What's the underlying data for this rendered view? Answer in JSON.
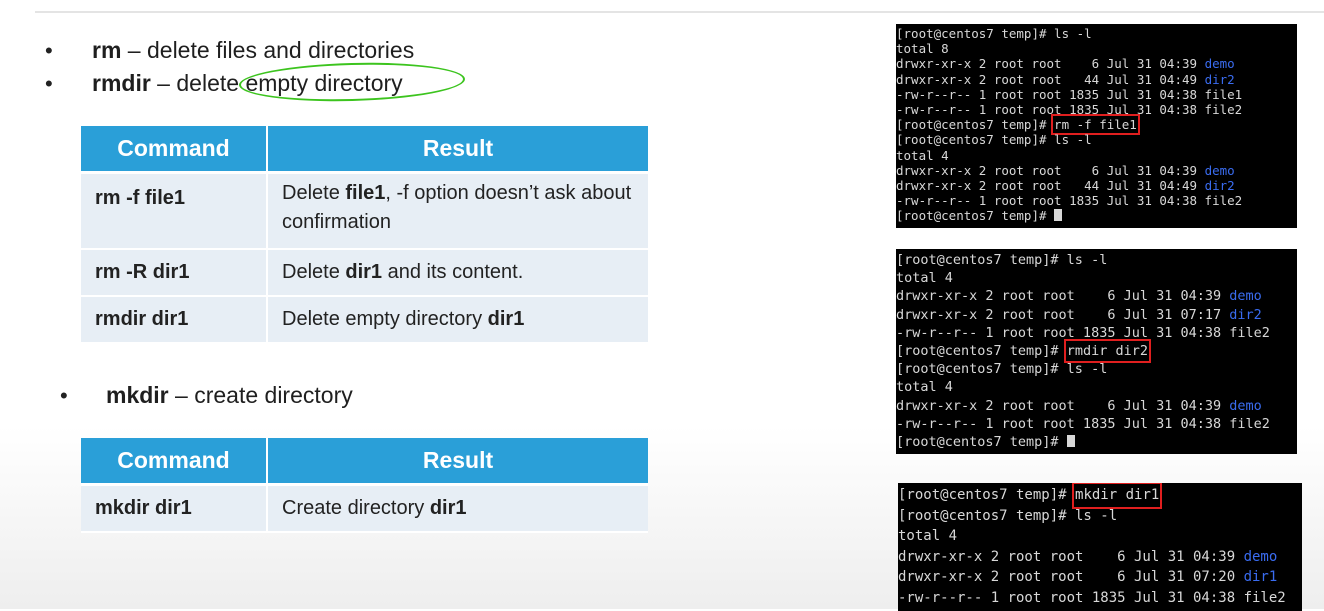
{
  "bullets": [
    {
      "cmd": "rm",
      "sep": " – ",
      "desc": "delete files and directories"
    },
    {
      "cmd": "rmdir",
      "sep": " – ",
      "desc_before": "delete ",
      "desc_highlight": "empty directory"
    },
    {
      "cmd": "mkdir",
      "sep": " – ",
      "desc": "create directory"
    }
  ],
  "table1": {
    "headers": [
      "Command",
      "Result"
    ],
    "rows": [
      {
        "command": "rm -f file1",
        "pre": "Delete ",
        "bold": "file1",
        "post": ", -f option doesn’t ask about confirmation"
      },
      {
        "command": "rm -R dir1",
        "pre": "Delete ",
        "bold": "dir1",
        "post": " and its content."
      },
      {
        "command": "rmdir dir1",
        "pre": "Delete empty directory ",
        "bold": "dir1",
        "post": ""
      }
    ]
  },
  "table2": {
    "headers": [
      "Command",
      "Result"
    ],
    "rows": [
      {
        "command": "mkdir dir1",
        "pre": "Create directory ",
        "bold": "dir1",
        "post": ""
      }
    ]
  },
  "terminal1": {
    "lines": [
      {
        "text": "[root@centos7 temp]# ls -l"
      },
      {
        "text": "total 8"
      },
      {
        "text": "drwxr-xr-x 2 root root    6 Jul 31 04:39 ",
        "blue": "demo"
      },
      {
        "text": "drwxr-xr-x 2 root root   44 Jul 31 04:49 ",
        "blue": "dir2"
      },
      {
        "text": "-rw-r--r-- 1 root root 1835 Jul 31 04:38 file1"
      },
      {
        "text": "-rw-r--r-- 1 root root 1835 Jul 31 04:38 file2"
      },
      {
        "text": "[root@centos7 temp]# ",
        "boxed": "rm -f file1"
      },
      {
        "text": "[root@centos7 temp]# ls -l"
      },
      {
        "text": "total 4"
      },
      {
        "text": "drwxr-xr-x 2 root root    6 Jul 31 04:39 ",
        "blue": "demo"
      },
      {
        "text": "drwxr-xr-x 2 root root   44 Jul 31 04:49 ",
        "blue": "dir2"
      },
      {
        "text": "-rw-r--r-- 1 root root 1835 Jul 31 04:38 file2"
      },
      {
        "text": "[root@centos7 temp]# ",
        "cursor": true
      }
    ]
  },
  "terminal2": {
    "lines": [
      {
        "text": "[root@centos7 temp]# ls -l"
      },
      {
        "text": "total 4"
      },
      {
        "text": "drwxr-xr-x 2 root root    6 Jul 31 04:39 ",
        "blue": "demo"
      },
      {
        "text": "drwxr-xr-x 2 root root    6 Jul 31 07:17 ",
        "blue": "dir2"
      },
      {
        "text": "-rw-r--r-- 1 root root 1835 Jul 31 04:38 file2"
      },
      {
        "text": "[root@centos7 temp]# ",
        "boxed": "rmdir dir2"
      },
      {
        "text": "[root@centos7 temp]# ls -l"
      },
      {
        "text": "total 4"
      },
      {
        "text": "drwxr-xr-x 2 root root    6 Jul 31 04:39 ",
        "blue": "demo"
      },
      {
        "text": "-rw-r--r-- 1 root root 1835 Jul 31 04:38 file2"
      },
      {
        "text": "[root@centos7 temp]# ",
        "cursor": true
      }
    ]
  },
  "terminal3": {
    "lines": [
      {
        "text": "[root@centos7 temp]# ",
        "boxed": "mkdir dir1"
      },
      {
        "text": "[root@centos7 temp]# ls -l"
      },
      {
        "text": "total 4"
      },
      {
        "text": "drwxr-xr-x 2 root root    6 Jul 31 04:39 ",
        "blue": "demo"
      },
      {
        "text": "drwxr-xr-x 2 root root    6 Jul 31 07:20 ",
        "blue": "dir1"
      },
      {
        "text": "-rw-r--r-- 1 root root 1835 Jul 31 04:38 file2"
      }
    ]
  },
  "colors": {
    "table_header": "#2a9fd8",
    "table_row": "#e7eef5",
    "highlight_circle": "#3cc41e",
    "terminal_box": "#e01f1f",
    "terminal_dir": "#3a6cf0"
  }
}
